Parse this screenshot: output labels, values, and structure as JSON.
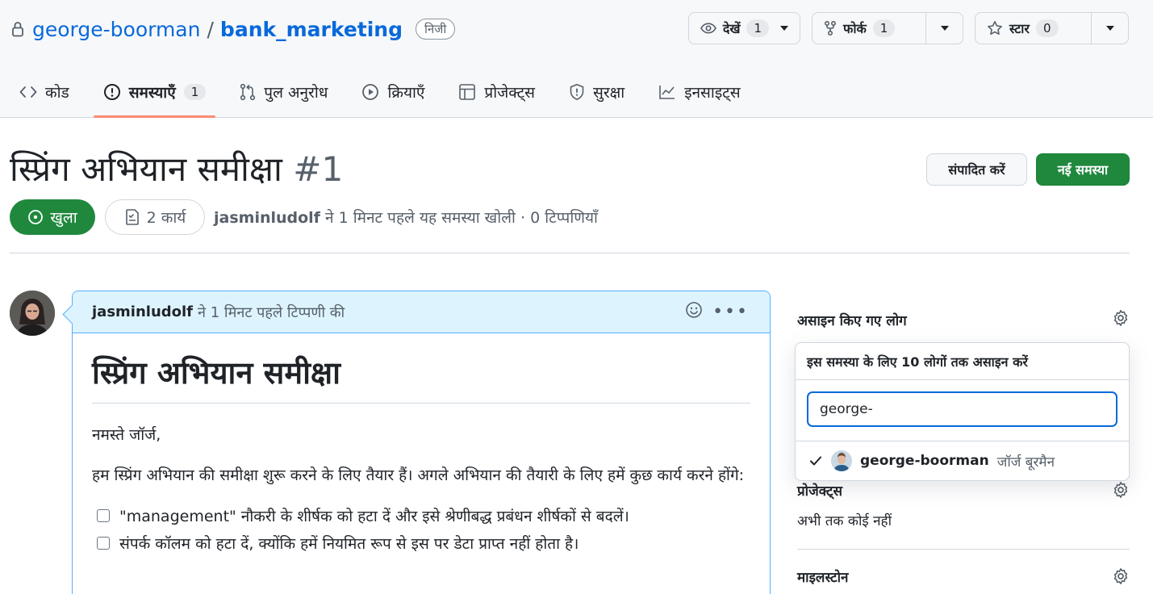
{
  "repo": {
    "owner": "george-boorman",
    "separator": "/",
    "name": "bank_marketing",
    "visibility": "निजी"
  },
  "repo_actions": {
    "watch": {
      "label": "देखें",
      "count": "1"
    },
    "fork": {
      "label": "फोर्क",
      "count": "1"
    },
    "star": {
      "label": "स्टार",
      "count": "0"
    }
  },
  "tabs": [
    {
      "label": "कोड",
      "icon": "code-icon"
    },
    {
      "label": "समस्याएँ",
      "icon": "issue-icon",
      "count": "1",
      "active": true
    },
    {
      "label": "पुल अनुरोध",
      "icon": "pull-request-icon"
    },
    {
      "label": "क्रियाएँ",
      "icon": "play-icon"
    },
    {
      "label": "प्रोजेक्ट्स",
      "icon": "table-icon"
    },
    {
      "label": "सुरक्षा",
      "icon": "shield-icon"
    },
    {
      "label": "इनसाइट्स",
      "icon": "graph-icon"
    }
  ],
  "issue": {
    "title": "स्प्रिंग अभियान समीक्षा",
    "number": "#1",
    "edit_label": "संपादित करें",
    "new_label": "नई समस्या",
    "state": "खुला",
    "tasks": "2 कार्य",
    "author": "jasminludolf",
    "meta_text": "ने 1 मिनट पहले यह समस्या खोली · 0 टिप्पणियाँ"
  },
  "comment": {
    "author": "jasminludolf",
    "meta": "ने 1 मिनट पहले टिप्पणी की",
    "heading": "स्प्रिंग अभियान समीक्षा",
    "greeting": "नमस्ते जॉर्ज,",
    "paragraph": "हम स्प्रिंग अभियान की समीक्षा शुरू करने के लिए तैयार हैं। अगले अभियान की तैयारी के लिए हमें कुछ कार्य करने होंगे:",
    "tasks": [
      "\"management\" नौकरी के शीर्षक को हटा दें और इसे श्रेणीबद्ध प्रबंधन शीर्षकों से बदलें।",
      "संपर्क कॉलम को हटा दें, क्योंकि हमें नियमित रूप से इस पर डेटा प्राप्त नहीं होता है।"
    ]
  },
  "sidebar": {
    "assignees": {
      "title": "असाइन किए गए लोग",
      "popover_title": "इस समस्या के लिए 10 लोगों तक असाइन करें",
      "filter_value": "george-",
      "result": {
        "login": "george-boorman",
        "name": "जॉर्ज बूरमैन",
        "selected": true
      }
    },
    "projects": {
      "title": "प्रोजेक्ट्स",
      "empty": "अभी तक कोई नहीं"
    },
    "milestone": {
      "title": "माइलस्टोन"
    }
  },
  "colors": {
    "link": "#0969da",
    "open_green": "#1f883d",
    "active_tab_underline": "#fd8c73",
    "comment_header": "#ddf4ff",
    "comment_border": "#54aeff"
  }
}
